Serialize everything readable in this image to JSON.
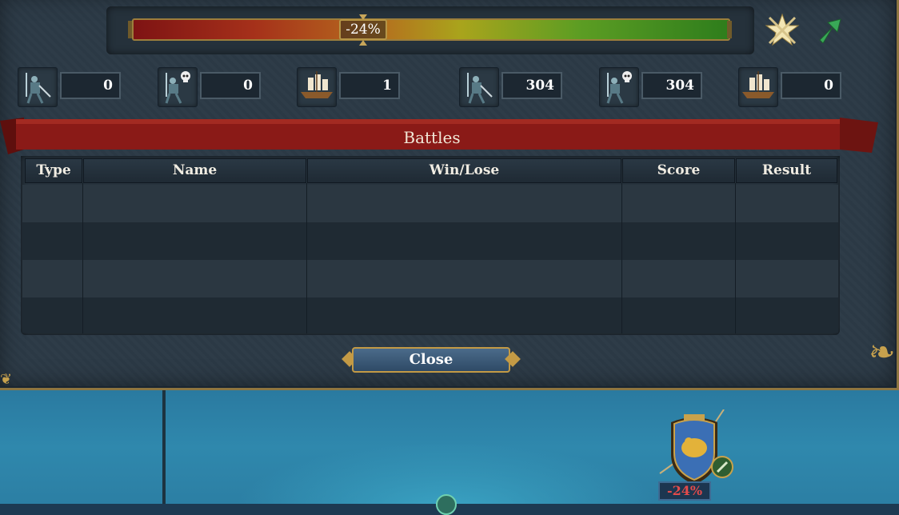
{
  "war_score": {
    "label": "-24%",
    "value_percent": -24
  },
  "stats": [
    {
      "icon": "infantry-icon",
      "value": "0"
    },
    {
      "icon": "infantry-skull-icon",
      "value": "0"
    },
    {
      "icon": "ship-icon",
      "value": "1"
    },
    {
      "icon": "infantry-icon",
      "value": "304"
    },
    {
      "icon": "infantry-skull-icon",
      "value": "304"
    },
    {
      "icon": "ship-icon",
      "value": "0"
    }
  ],
  "battles": {
    "title": "Battles",
    "columns": [
      "Type",
      "Name",
      "Win/Lose",
      "Score",
      "Result"
    ],
    "rows": []
  },
  "close_label": "Close",
  "emblem": {
    "label": "-24%"
  },
  "colors": {
    "panel": "#2c3a46",
    "gold_border": "#8e7540",
    "banner_red": "#8a1a17",
    "negative": "#e24b4b"
  }
}
